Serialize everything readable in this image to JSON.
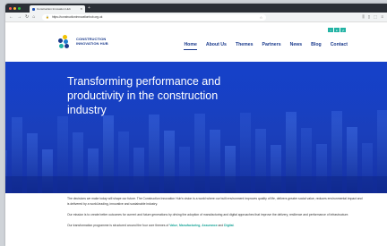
{
  "browser": {
    "tab_title": "Construction Innovation Hub",
    "url": "https://constructioninnovationhub.org.uk"
  },
  "logo": {
    "line1": "CONSTRUCTION",
    "line2": "INNOVATION HUB"
  },
  "social": [
    "t",
    "in",
    "yt"
  ],
  "nav": {
    "items": [
      "Home",
      "About Us",
      "Themes",
      "Partners",
      "News",
      "Blog",
      "Contact"
    ],
    "active": "Home"
  },
  "hero": {
    "title": "Transforming performance and productivity in the construction industry"
  },
  "content": {
    "p1": "The decisions we make today will shape our future. The Construction Innovation Hub's vision is a world where our built environment improves quality of life, delivers greater social value, reduces environmental impact and is delivered by a world-leading, innovative and sustainable industry.",
    "p2": "Our mission is to create better outcomes for current and future generations by driving the adoption of manufacturing and digital approaches that improve the delivery, resilience and performance of infrastructure.",
    "p3_prefix": "Our transformation programme is structured around the four core themes of",
    "themes": [
      "Value",
      "Manufacturing",
      "Assurance",
      "Digital"
    ],
    "sep1": ",",
    "sep2": ",",
    "sep3": "and",
    "end": "."
  }
}
